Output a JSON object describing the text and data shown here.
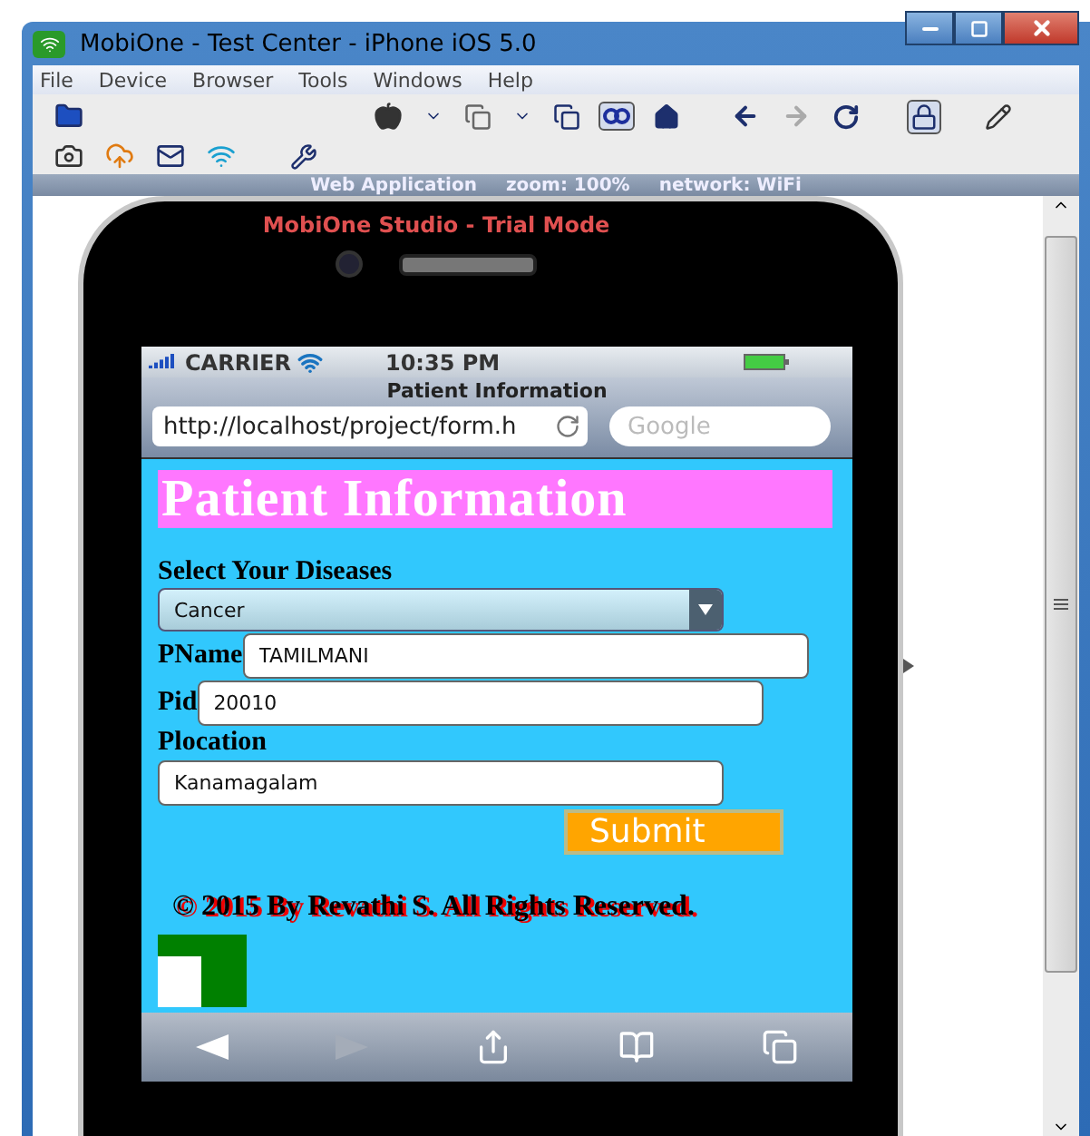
{
  "window": {
    "title": "MobiOne - Test Center - iPhone iOS 5.0"
  },
  "menu": [
    "File",
    "Device",
    "Browser",
    "Tools",
    "Windows",
    "Help"
  ],
  "toolbar": {
    "forward_disabled": true,
    "view_selected": true,
    "lock_selected": true
  },
  "status_strip": [
    "Web Application",
    "zoom: 100%",
    "network: WiFi"
  ],
  "phone": {
    "banner": "MobiOne Studio - Trial Mode",
    "status": {
      "carrier": "CARRIER",
      "time": "10:35 PM"
    },
    "browser": {
      "title": "Patient Information",
      "url": "http://localhost/project/form.h",
      "search_placeholder": "Google",
      "forward_disabled": true
    },
    "page": {
      "heading": "Patient Information",
      "select_label": "Select Your Diseases",
      "select_value": "Cancer",
      "fields": [
        {
          "kind": "inline",
          "label": "PName",
          "value": "TAMILMANI"
        },
        {
          "kind": "inline",
          "label": "Pid",
          "value": "20010"
        },
        {
          "kind": "stacked",
          "label": "Plocation",
          "value": "Kanamagalam"
        }
      ],
      "submit": "Submit",
      "footer": "© 2015 By Revathi S. All Rights Reserved."
    }
  }
}
